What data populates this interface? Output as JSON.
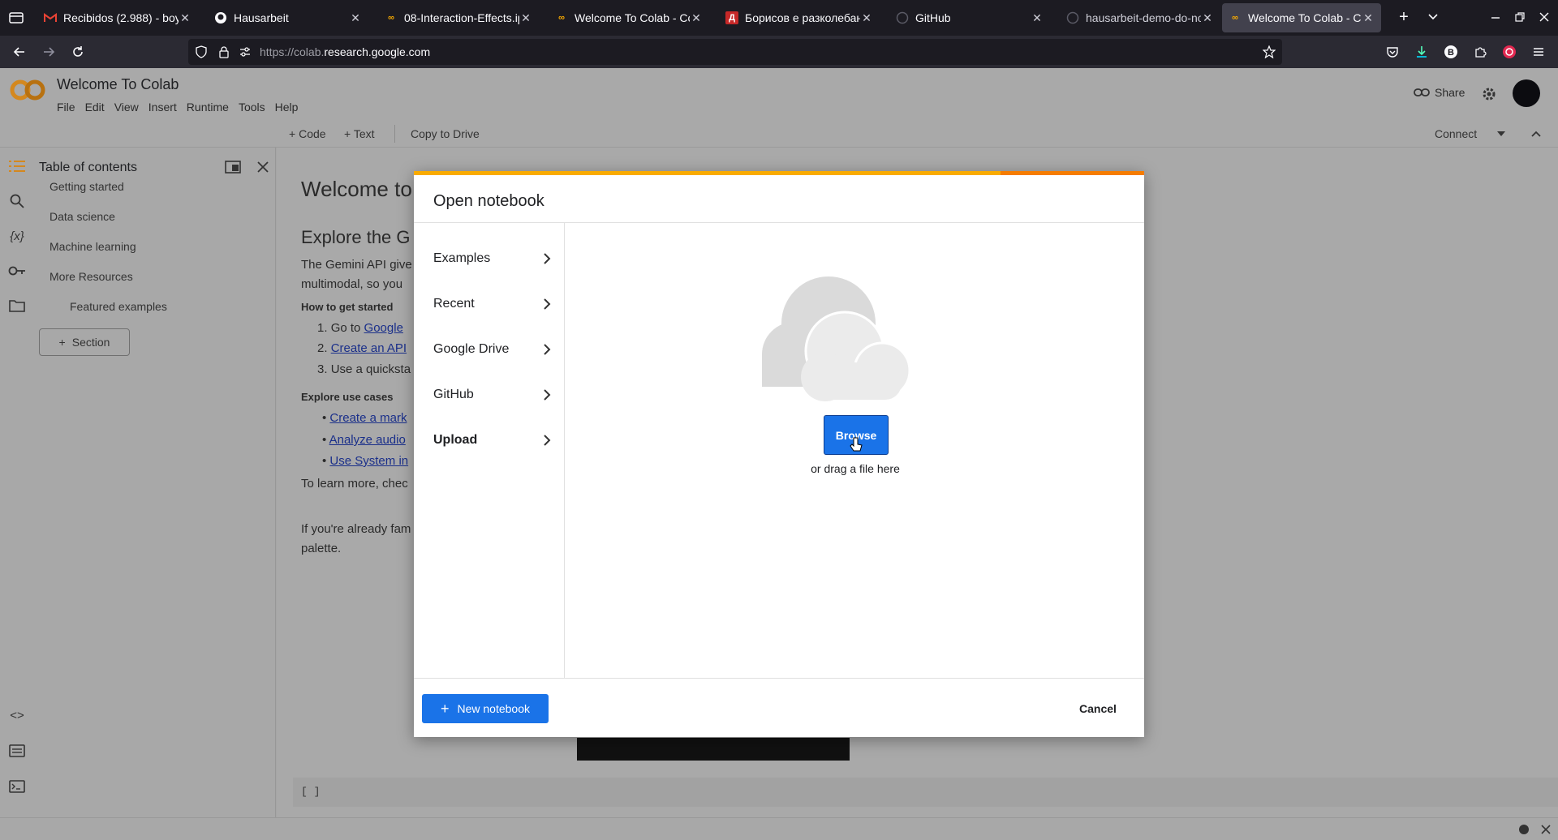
{
  "browser": {
    "tabs": [
      {
        "title": "Recibidos (2.988) - boyk",
        "icon": "gmail-icon"
      },
      {
        "title": "Hausarbeit",
        "icon": "github-icon"
      },
      {
        "title": "08-Interaction-Effects.ip",
        "icon": "colab-icon"
      },
      {
        "title": "Welcome To Colab - Col",
        "icon": "colab-icon"
      },
      {
        "title": "Борисов е разколебан",
        "icon": "news-icon"
      },
      {
        "title": "GitHub",
        "icon": "github-icon"
      },
      {
        "title": "hausarbeit-demo-do-no",
        "icon": "github-icon"
      },
      {
        "title": "Welcome To Colab - Col",
        "icon": "colab-icon",
        "active": true
      }
    ],
    "url_prefix": "https://colab.",
    "url_domain": "research.google.com",
    "url_tail": ""
  },
  "colab": {
    "title": "Welcome To Colab",
    "menu": [
      "File",
      "Edit",
      "View",
      "Insert",
      "Runtime",
      "Tools",
      "Help"
    ],
    "share_label": "Share",
    "toolbar": {
      "code": "Code",
      "text": "Text",
      "copy": "Copy to Drive",
      "connect": "Connect"
    },
    "sidebar": {
      "title": "Table of contents",
      "items": [
        "Getting started",
        "Data science",
        "Machine learning",
        "More Resources",
        "Featured examples"
      ],
      "section_button": "Section"
    },
    "content": {
      "h1": "Welcome to",
      "h2": "Explore the G",
      "p1a": "The Gemini API give",
      "p1b": "multimodal, so you",
      "how_title": "How to get started",
      "steps": [
        "Go to ",
        "Create an API",
        "Use a quicksta"
      ],
      "step1_link": "Google",
      "explore_title": "Explore use cases",
      "bullets": [
        "Create a mark",
        "Analyze audio",
        "Use System in"
      ],
      "p2": "To learn more, chec",
      "p3a": "If you're already fam",
      "p3b": "palette.",
      "cell_brackets": "[ ]"
    }
  },
  "dialog": {
    "title": "Open notebook",
    "nav": [
      "Examples",
      "Recent",
      "Google Drive",
      "GitHub",
      "Upload"
    ],
    "active": "Upload",
    "browse_label": "Browse",
    "drag_text": "or drag a file here",
    "new_notebook": "New notebook",
    "cancel": "Cancel"
  },
  "colors": {
    "accent": "#1a73e8",
    "progress": "#f9ab00",
    "progress_rest": "#f57c00",
    "colab_orange": "#f9ab00"
  }
}
